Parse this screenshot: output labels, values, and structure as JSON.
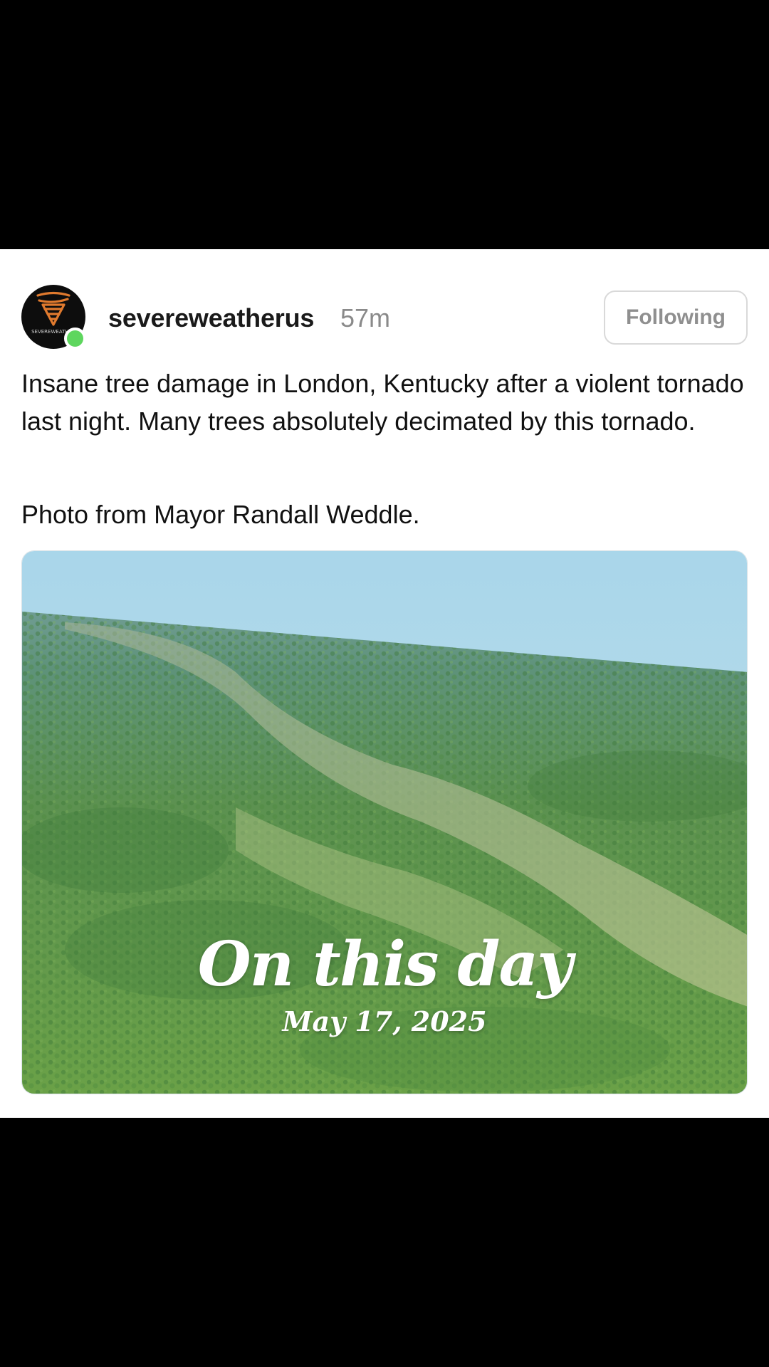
{
  "post": {
    "username": "severeweatherus",
    "timestamp": "57m",
    "follow_label": "Following",
    "avatar_text": "SEVEREWEATHER",
    "body": "Insane tree damage in London, Kentucky after a violent tornado last night. Many trees absolutely decimated by this tornado.",
    "credit": "Photo from Mayor Randall Weddle.",
    "image": {
      "overlay_title": "On this day",
      "overlay_date": "May 17, 2025"
    }
  },
  "colors": {
    "online": "#5ed65e",
    "avatar_bg": "#0d0d0d",
    "avatar_logo": "#e07a2e",
    "sky": "#a9d6ea",
    "forest": "#5f9a4a"
  }
}
